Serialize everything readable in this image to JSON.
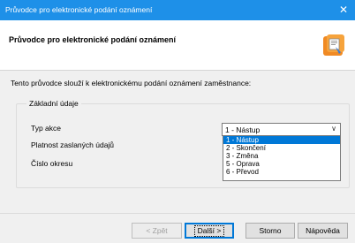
{
  "window": {
    "title": "Průvodce pro elektronické podání oznámení",
    "close_glyph": "✕"
  },
  "header": {
    "title": "Průvodce pro elektronické podání oznámení"
  },
  "description": "Tento průvodce slouží k elektronickému podání oznámení zaměstnance:",
  "group": {
    "legend": "Základní údaje",
    "labels": {
      "typ_akce": "Typ akce",
      "platnost": "Platnost zaslaných údajů",
      "cislo_okresu": "Číslo okresu"
    }
  },
  "select": {
    "value": "1 - Nástup",
    "options": [
      "1 - Nástup",
      "2 - Skončení",
      "3 - Změna",
      "5 - Oprava",
      "6 - Převod"
    ],
    "selected_index": 0
  },
  "buttons": {
    "back": "< Zpět",
    "next": "Další >",
    "cancel": "Storno",
    "help": "Nápověda"
  },
  "colors": {
    "titlebar": "#1e90e8",
    "selection": "#0078d7"
  },
  "icons": {
    "close": "close-icon",
    "wizard": "wizard-icon",
    "dropdown": "chevron-down-icon"
  }
}
